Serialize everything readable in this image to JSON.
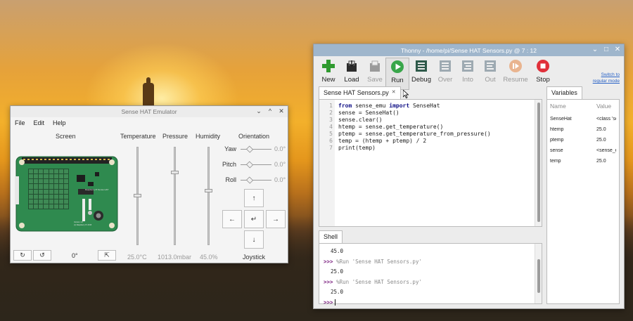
{
  "emulator": {
    "title": "Sense HAT Emulator",
    "menu": [
      "File",
      "Edit",
      "Help"
    ],
    "screen_label": "Screen",
    "screen_angle": "0°",
    "rotate_buttons": [
      "↻",
      "↺"
    ],
    "export_button": "⇱",
    "sliders": {
      "temperature": {
        "label": "Temperature",
        "value": "25.0°C",
        "level": 0.5
      },
      "pressure": {
        "label": "Pressure",
        "value": "1013.0mbar",
        "level": 0.75
      },
      "humidity": {
        "label": "Humidity",
        "value": "45.0%",
        "level": 0.55
      }
    },
    "orientation": {
      "label": "Orientation",
      "axes": [
        {
          "name": "Yaw",
          "value": "0.0°"
        },
        {
          "name": "Pitch",
          "value": "0.0°"
        },
        {
          "name": "Roll",
          "value": "0.0°"
        }
      ]
    },
    "joystick": {
      "label": "Joystick",
      "up": "↑",
      "down": "↓",
      "left": "←",
      "right": "→",
      "enter": "↵"
    },
    "board_text": {
      "model": "Raspberry Pi Sense HAT",
      "version": "Version 1.0",
      "copyright": "(c) Raspberry Pi 2015"
    }
  },
  "thonny": {
    "title": "Thonny  -  /home/pi/Sense HAT Sensors.py  @  7 : 12",
    "toolbar": [
      {
        "label": "New",
        "icon": "new-icon",
        "enabled": true
      },
      {
        "label": "Load",
        "icon": "load-icon",
        "enabled": true
      },
      {
        "label": "Save",
        "icon": "save-icon",
        "enabled": false
      },
      {
        "label": "Run",
        "icon": "run-icon",
        "enabled": true
      },
      {
        "label": "Debug",
        "icon": "debug-icon",
        "enabled": true
      },
      {
        "label": "Over",
        "icon": "step-over-icon",
        "enabled": false
      },
      {
        "label": "Into",
        "icon": "step-into-icon",
        "enabled": false
      },
      {
        "label": "Out",
        "icon": "step-out-icon",
        "enabled": false
      },
      {
        "label": "Resume",
        "icon": "resume-icon",
        "enabled": false
      },
      {
        "label": "Stop",
        "icon": "stop-icon",
        "enabled": true
      }
    ],
    "switch_mode": [
      "Switch to",
      "regular mode"
    ],
    "editor": {
      "tab": "Sense HAT Sensors.py",
      "tab_close": "✕",
      "lines": [
        {
          "n": "1",
          "kw": "from",
          "rest": " sense_emu ",
          "kw2": "import",
          "rest2": " SenseHat"
        },
        {
          "n": "2",
          "kw": "",
          "rest": "sense = SenseHat()",
          "kw2": "",
          "rest2": ""
        },
        {
          "n": "3",
          "kw": "",
          "rest": "sense.clear()",
          "kw2": "",
          "rest2": ""
        },
        {
          "n": "4",
          "kw": "",
          "rest": "htemp = sense.get_temperature()",
          "kw2": "",
          "rest2": ""
        },
        {
          "n": "5",
          "kw": "",
          "rest": "ptemp = sense.get_temperature_from_pressure()",
          "kw2": "",
          "rest2": ""
        },
        {
          "n": "6",
          "kw": "",
          "rest": "temp = (htemp + ptemp) / 2",
          "kw2": "",
          "rest2": ""
        },
        {
          "n": "7",
          "kw": "",
          "rest": "print(temp)",
          "kw2": "",
          "rest2": ""
        }
      ]
    },
    "variables": {
      "tab": "Variables",
      "headers": [
        "Name",
        "Value"
      ],
      "rows": [
        {
          "name": "SenseHat",
          "value": "<class 'se"
        },
        {
          "name": "htemp",
          "value": "25.0"
        },
        {
          "name": "ptemp",
          "value": "25.0"
        },
        {
          "name": "sense",
          "value": "<sense_en"
        },
        {
          "name": "temp",
          "value": "25.0"
        }
      ]
    },
    "shell": {
      "tab": "Shell",
      "first_output": "45.0",
      "prompt": ">>>",
      "runs": [
        {
          "cmd": "%Run 'Sense HAT Sensors.py'",
          "output": "25.0"
        },
        {
          "cmd": "%Run 'Sense HAT Sensors.py'",
          "output": "25.0"
        }
      ]
    }
  }
}
